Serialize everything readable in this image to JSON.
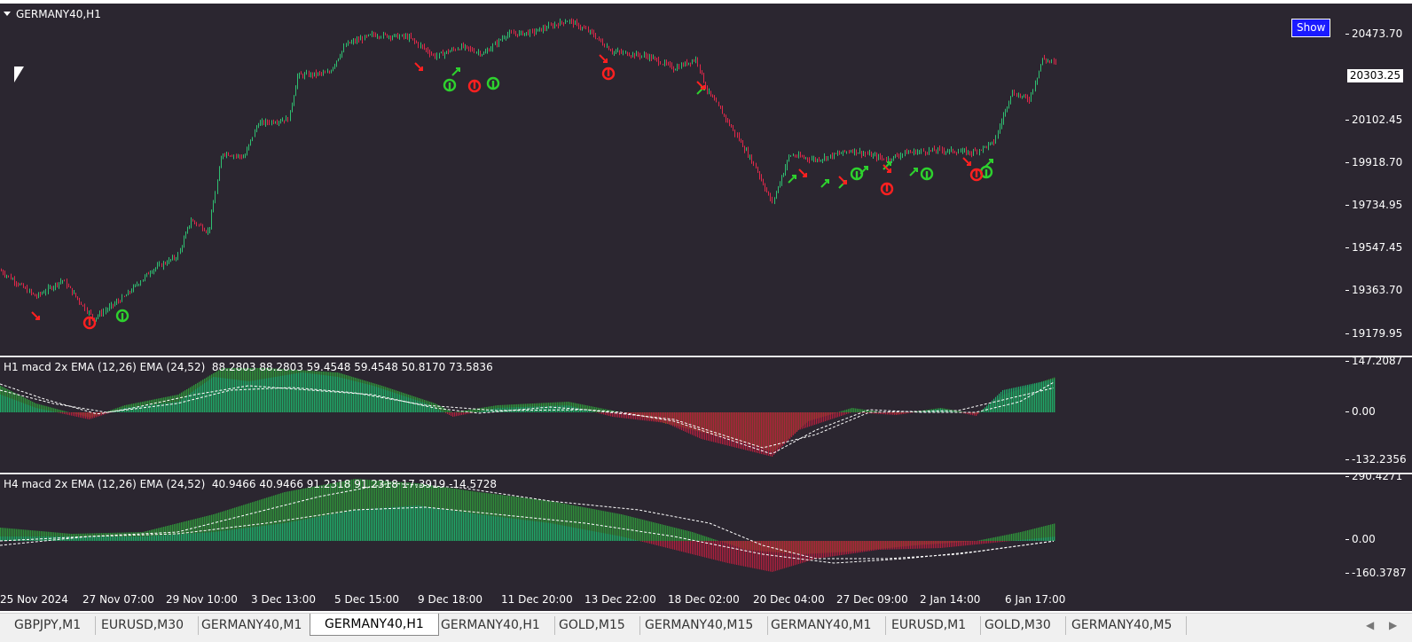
{
  "main": {
    "symbol_title": "GERMANY40,H1",
    "show_button": "Show",
    "current_price": "20303.25",
    "price_ticks": [
      "20473.70",
      "20102.45",
      "19918.70",
      "19734.95",
      "19547.45",
      "19363.70",
      "19179.95"
    ],
    "price_range": [
      19130,
      20520
    ],
    "colors": {
      "bull": "#2fbf71",
      "bear": "#e0284a",
      "background": "#2b2630",
      "arrow_up": "#2ed12e",
      "arrow_down": "#ff2020"
    }
  },
  "h1_indicator": {
    "title": "H1 macd 2x EMA (12,26) EMA (24,52)  88.2803 88.2803 59.4548 59.4548 50.8170 73.5836",
    "ticks": [
      "147.2087",
      "0.00",
      "-132.2356"
    ]
  },
  "h4_indicator": {
    "title": "H4 macd 2x EMA (12,26) EMA (24,52)  40.9466 40.9466 91.2318 91.2318 17.3919 -14.5728",
    "ticks": [
      "290.4271",
      "0.00",
      "-160.3787"
    ]
  },
  "time_axis": {
    "labels": [
      "25 Nov 2024",
      "27 Nov 07:00",
      "29 Nov 10:00",
      "3 Dec 13:00",
      "5 Dec 15:00",
      "9 Dec 18:00",
      "11 Dec 20:00",
      "13 Dec 22:00",
      "18 Dec 02:00",
      "20 Dec 04:00",
      "27 Dec 09:00",
      "2 Jan 14:00",
      "6 Jan 17:00"
    ]
  },
  "tabs": [
    {
      "label": "GBPJPY,M1",
      "active": false
    },
    {
      "label": "EURUSD,M30",
      "active": false
    },
    {
      "label": "GERMANY40,M1",
      "active": false
    },
    {
      "label": "GERMANY40,H1",
      "active": true
    },
    {
      "label": "GERMANY40,H1",
      "active": false
    },
    {
      "label": "GOLD,M15",
      "active": false
    },
    {
      "label": "GERMANY40,M15",
      "active": false
    },
    {
      "label": "GERMANY40,M1",
      "active": false
    },
    {
      "label": "EURUSD,M1",
      "active": false
    },
    {
      "label": "GOLD,M30",
      "active": false
    },
    {
      "label": "GERMANY40,M5",
      "active": false
    }
  ],
  "tab_nav": {
    "left": "◀",
    "right": "▶"
  }
}
